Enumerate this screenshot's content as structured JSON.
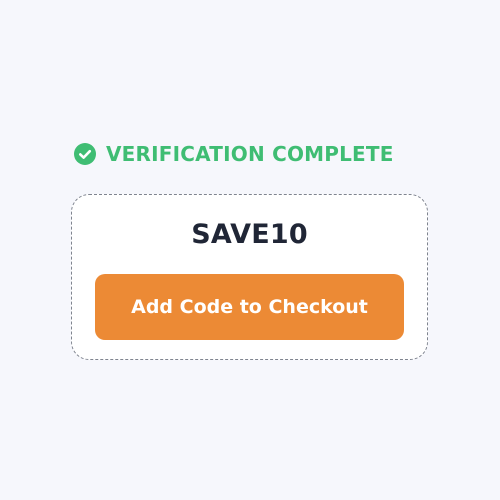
{
  "status": {
    "icon": "check-circle-icon",
    "text": "VERIFICATION COMPLETE",
    "color": "#3fbd73"
  },
  "coupon": {
    "code": "SAVE10",
    "button_label": "Add Code to Checkout",
    "button_color": "#ec8a35"
  }
}
